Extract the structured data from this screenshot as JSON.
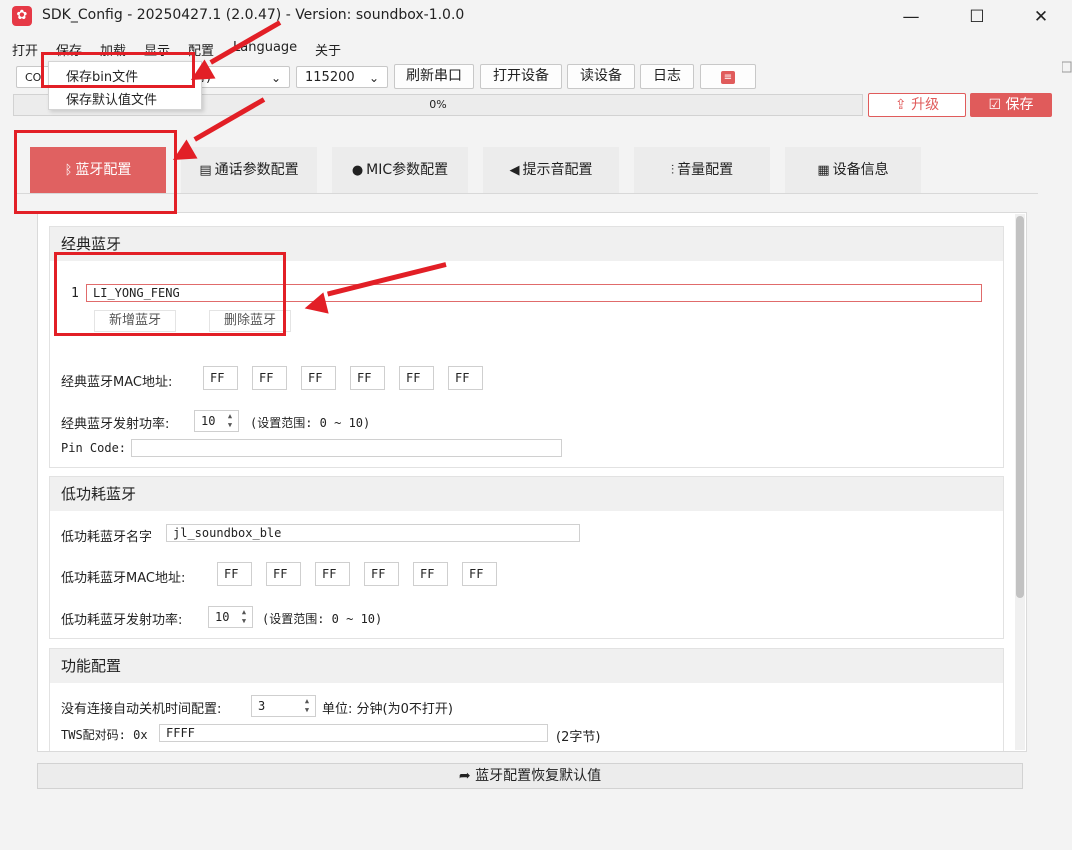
{
  "window": {
    "title": "SDK_Config -  20250427.1  (2.0.47) - Version: soundbox-1.0.0",
    "minimize": "—",
    "maximize": "☐",
    "close": "✕"
  },
  "menu": {
    "items": [
      "打开",
      "保存",
      "加载",
      "显示",
      "配置",
      "Language",
      "关于"
    ]
  },
  "dropdown": {
    "items": [
      "保存bin文件",
      "保存默认值文件"
    ]
  },
  "toolbar": {
    "port_prefix": "CO",
    "port_suffix": "行)",
    "baud": "115200",
    "refresh_port": "刷新串口",
    "open_device": "打开设备",
    "read_device": "读设备",
    "log": "日志",
    "settings_icon": "sliders-icon"
  },
  "progress": {
    "value": 0,
    "label": "0%"
  },
  "actions": {
    "upgrade": "升级",
    "save": "保存"
  },
  "tabs": [
    {
      "label": "蓝牙配置",
      "icon": "bluetooth-icon",
      "active": true
    },
    {
      "label": "通话参数配置",
      "icon": "clipboard-icon",
      "active": false
    },
    {
      "label": "MIC参数配置",
      "icon": "mic-icon",
      "active": false
    },
    {
      "label": "提示音配置",
      "icon": "speaker-icon",
      "active": false
    },
    {
      "label": "音量配置",
      "icon": "waveform-icon",
      "active": false
    },
    {
      "label": "设备信息",
      "icon": "document-icon",
      "active": false
    }
  ],
  "classic_bt": {
    "title": "经典蓝牙",
    "devices": [
      {
        "index": "1",
        "name": "LI_YONG_FENG"
      }
    ],
    "add_button": "新增蓝牙",
    "delete_button": "删除蓝牙",
    "mac_label": "经典蓝牙MAC地址:",
    "mac": [
      "FF",
      "FF",
      "FF",
      "FF",
      "FF",
      "FF"
    ],
    "power_label": "经典蓝牙发射功率:",
    "power_value": "10",
    "power_range": "(设置范围: 0 ~ 10)",
    "pin_label": "Pin Code:",
    "pin_value": ""
  },
  "ble": {
    "title": "低功耗蓝牙",
    "name_label": "低功耗蓝牙名字",
    "name_value": "jl_soundbox_ble",
    "mac_label": "低功耗蓝牙MAC地址:",
    "mac": [
      "FF",
      "FF",
      "FF",
      "FF",
      "FF",
      "FF"
    ],
    "power_label": "低功耗蓝牙发射功率:",
    "power_value": "10",
    "power_range": "(设置范围: 0 ~ 10)"
  },
  "function_cfg": {
    "title": "功能配置",
    "auto_off_label": "没有连接自动关机时间配置:",
    "auto_off_value": "3",
    "auto_off_unit": "单位: 分钟(为0不打开)",
    "tws_label": "TWS配对码: 0x",
    "tws_value": "FFFF",
    "tws_hint": "(2字节)"
  },
  "restore_button": "蓝牙配置恢复默认值",
  "colors": {
    "accent": "#e06161",
    "annotation": "#e21f26"
  }
}
